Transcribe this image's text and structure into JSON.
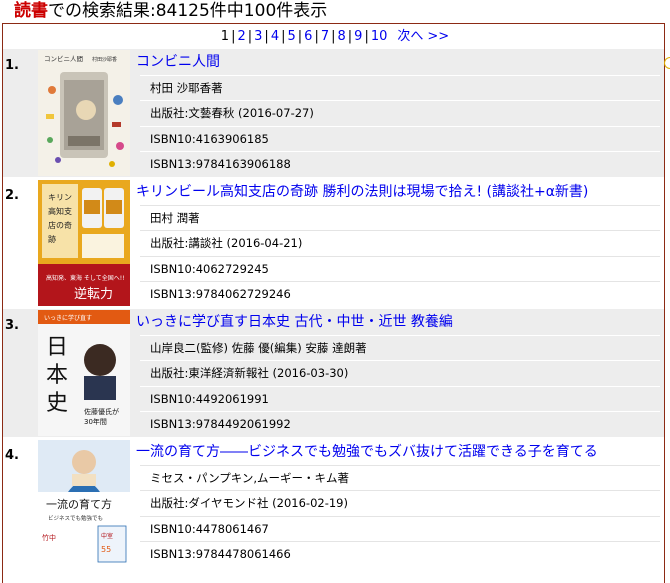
{
  "header": {
    "keyword": "読書",
    "rest": "での検索結果:84125件中100件表示"
  },
  "pager": {
    "current": "1",
    "pages": [
      "2",
      "3",
      "4",
      "5",
      "6",
      "7",
      "8",
      "9",
      "10"
    ],
    "next": "次へ",
    "last": ">>"
  },
  "books": [
    {
      "num": "1.",
      "title": "コンビニ人間",
      "author": "村田 沙耶香著",
      "publisher": "出版社:文藝春秋 (2016-07-27)",
      "isbn10": "ISBN10:4163906185",
      "isbn13": "ISBN13:9784163906188",
      "cover": {
        "top": "コンビニ人間",
        "author": "村田沙耶香",
        "bg": "#f4f1e8",
        "accent": "#b43a2a"
      }
    },
    {
      "num": "2.",
      "title": "キリンビール高知支店の奇跡 勝利の法則は現場で拾え! (講談社+α新書)",
      "author": "田村 潤著",
      "publisher": "出版社:講談社 (2016-04-21)",
      "isbn10": "ISBN10:4062729245",
      "isbn13": "ISBN13:9784062729246",
      "cover": {
        "title": "キリンビール高知支店の奇跡",
        "sub": "逆転力",
        "bg": "#e9a81e",
        "accent": "#b3151b"
      }
    },
    {
      "num": "3.",
      "title": "いっきに学び直す日本史 古代・中世・近世 教養編",
      "author": "山岸良二(監修) 佐藤 優(編集) 安藤 達朗著",
      "publisher": "出版社:東洋経済新報社 (2016-03-30)",
      "isbn10": "ISBN10:4492061991",
      "isbn13": "ISBN13:9784492061992",
      "cover": {
        "title": "日本史",
        "sub": "佐藤優氏が30年間",
        "bg": "#f6f6f6",
        "accent": "#e25a12"
      }
    },
    {
      "num": "4.",
      "title": "一流の育て方――ビジネスでも勉強でもズバ抜けて活躍できる子を育てる",
      "author": "ミセス・パンプキン,ムーギー・キム著",
      "publisher": "出版社:ダイヤモンド社 (2016-02-19)",
      "isbn10": "ISBN10:4478061467",
      "isbn13": "ISBN13:9784478061466",
      "cover": {
        "title": "一流の育て方",
        "sub": "ビジネスでも勉強でも",
        "bg": "#ffffff",
        "accent": "#2b6fb3"
      }
    }
  ]
}
